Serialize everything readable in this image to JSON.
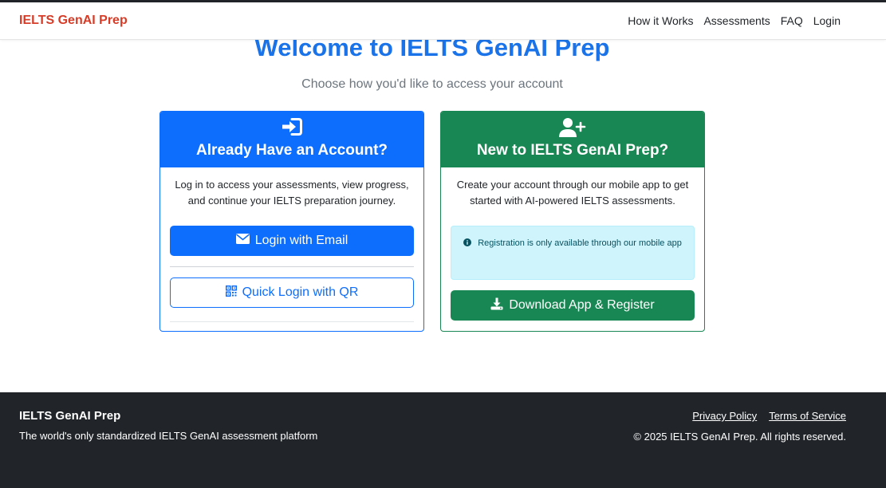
{
  "navbar": {
    "brand": "IELTS GenAI Prep",
    "links": [
      "How it Works",
      "Assessments",
      "FAQ",
      "Login"
    ]
  },
  "hero": {
    "title": "Welcome to IELTS GenAI Prep",
    "subtitle": "Choose how you'd like to access your account"
  },
  "login_card": {
    "icon": "sign-in-icon",
    "title": "Already Have an Account?",
    "text": "Log in to access your assessments, view progress, and continue your IELTS preparation journey.",
    "email_button": "Login with Email",
    "qr_button": "Quick Login with QR"
  },
  "register_card": {
    "icon": "user-plus-icon",
    "title": "New to IELTS GenAI Prep?",
    "text": "Create your account through our mobile app to get started with AI-powered IELTS assessments.",
    "alert": "Registration is only available through our mobile app",
    "download_button": "Download App & Register"
  },
  "footer": {
    "brand": "IELTS GenAI Prep",
    "tagline": "The world's only standardized IELTS GenAI assessment platform",
    "privacy": "Privacy Policy",
    "terms": "Terms of Service",
    "copyright": "© 2025 IELTS GenAI Prep. All rights reserved."
  },
  "colors": {
    "brand_red": "#d63c27",
    "primary": "#0d6efd",
    "success": "#198754",
    "title_blue": "#1a73e8",
    "footer_bg": "#212529",
    "alert_bg": "#cff4fc"
  }
}
